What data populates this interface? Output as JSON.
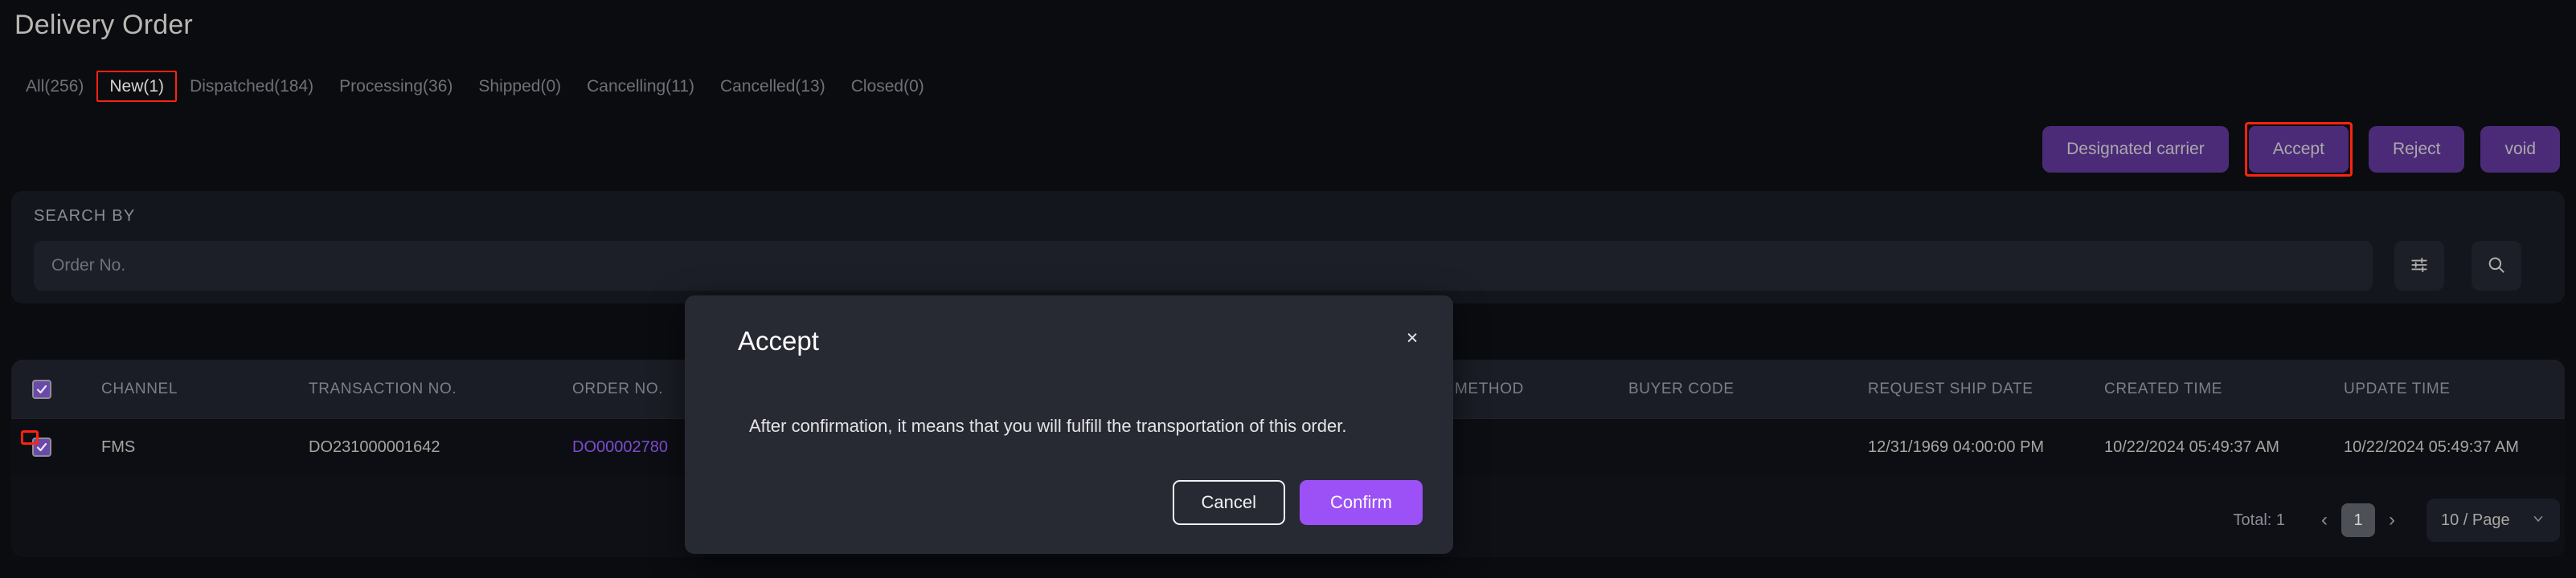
{
  "header": {
    "title": "Delivery Order"
  },
  "tabs": [
    {
      "label": "All(256)",
      "active": false,
      "highlighted": false,
      "name": "tab-all"
    },
    {
      "label": "New(1)",
      "active": true,
      "highlighted": true,
      "name": "tab-new"
    },
    {
      "label": "Dispatched(184)",
      "active": false,
      "highlighted": false,
      "name": "tab-dispatched"
    },
    {
      "label": "Processing(36)",
      "active": false,
      "highlighted": false,
      "name": "tab-processing"
    },
    {
      "label": "Shipped(0)",
      "active": false,
      "highlighted": false,
      "name": "tab-shipped"
    },
    {
      "label": "Cancelling(11)",
      "active": false,
      "highlighted": false,
      "name": "tab-cancelling"
    },
    {
      "label": "Cancelled(13)",
      "active": false,
      "highlighted": false,
      "name": "tab-cancelled"
    },
    {
      "label": "Closed(0)",
      "active": false,
      "highlighted": false,
      "name": "tab-closed"
    }
  ],
  "actions": {
    "designated_carrier": "Designated carrier",
    "accept": "Accept",
    "reject": "Reject",
    "void": "void"
  },
  "search": {
    "label": "SEARCH BY",
    "placeholder": "Order No.",
    "value": "",
    "filter_icon": "sliders-icon",
    "search_icon": "search-icon"
  },
  "table": {
    "columns": [
      "CHANNEL",
      "TRANSACTION NO.",
      "ORDER NO.",
      "METHOD",
      "BUYER CODE",
      "REQUEST SHIP DATE",
      "CREATED TIME",
      "UPDATE TIME"
    ],
    "rows": [
      {
        "selected": true,
        "channel": "FMS",
        "transaction_no": "DO231000001642",
        "order_no": "DO00002780",
        "method": "",
        "buyer_code": "",
        "request_ship_date": "12/31/1969 04:00:00 PM",
        "created_time": "10/22/2024 05:49:37 AM",
        "update_time": "10/22/2024 05:49:37 AM"
      }
    ]
  },
  "pagination": {
    "total": "Total: 1",
    "prev": "‹",
    "current_page": "1",
    "next": "›",
    "page_size": "10 / Page"
  },
  "modal": {
    "title": "Accept",
    "close": "×",
    "message": "After confirmation, it means that you will fulfill the transportation of this order.",
    "cancel": "Cancel",
    "confirm": "Confirm"
  },
  "colors": {
    "accent_purple": "#9b51f5",
    "button_purple": "#4b2b78",
    "highlight_red": "#ff2211",
    "link_purple": "#7c4dcf",
    "page_bg": "#0b0c10",
    "panel_bg": "#14161d",
    "modal_bg": "#272a33"
  }
}
